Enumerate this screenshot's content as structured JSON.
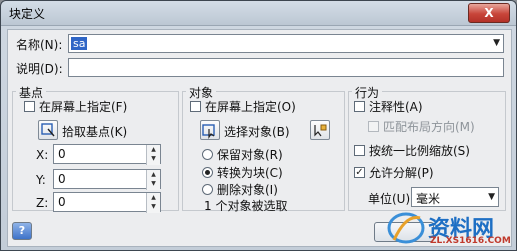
{
  "window": {
    "title": "块定义",
    "close_label": "X"
  },
  "name": {
    "label": "名称(N):",
    "value": "sa"
  },
  "description": {
    "label": "说明(D):",
    "value": ""
  },
  "base_point": {
    "group_label": "基点",
    "specify_on_screen_label": "在屏幕上指定(F)",
    "pick_label": "拾取基点(K)",
    "x_label": "X:",
    "x_value": "0",
    "y_label": "Y:",
    "y_value": "0",
    "z_label": "Z:",
    "z_value": "0"
  },
  "objects": {
    "group_label": "对象",
    "specify_on_screen_label": "在屏幕上指定(O)",
    "select_label": "选择对象(B)",
    "retain_label": "保留对象(R)",
    "convert_label": "转换为块(C)",
    "delete_label": "删除对象(I)",
    "selected_status": "1 个对象被选取",
    "mode_selected": "convert"
  },
  "behavior": {
    "group_label": "行为",
    "annotative_label": "注释性(A)",
    "match_layout_label": "匹配布局方向(M)",
    "scale_uniformly_label": "按统一比例缩放(S)",
    "allow_explode_label": "允许分解(P)",
    "unit_label": "单位(U):",
    "unit_value": "毫米"
  },
  "footer": {
    "help_label": "?"
  },
  "watermark": {
    "text": "资料网",
    "url": "ZL.XS1616.COM"
  }
}
